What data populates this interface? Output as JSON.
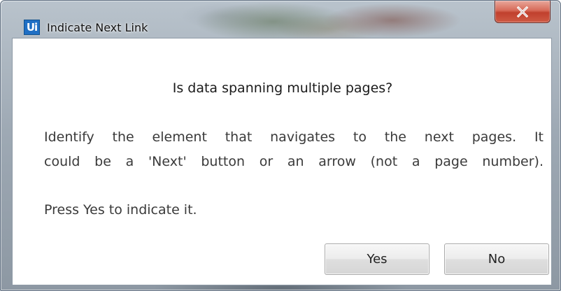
{
  "window": {
    "title": "Indicate Next Link",
    "app_icon_text": "Ui",
    "close_icon": "close-x-icon",
    "colors": {
      "app_icon_bg": "#1f6fc4",
      "close_button": "#c8432f"
    }
  },
  "dialog": {
    "heading": "Is data spanning multiple pages?",
    "description_line1": "Identify the element that navigates to the next pages. It",
    "description_line2": "could be a 'Next' button or an arrow (not a page number).",
    "prompt": "Press Yes to indicate it."
  },
  "buttons": {
    "yes_label": "Yes",
    "no_label": "No"
  }
}
